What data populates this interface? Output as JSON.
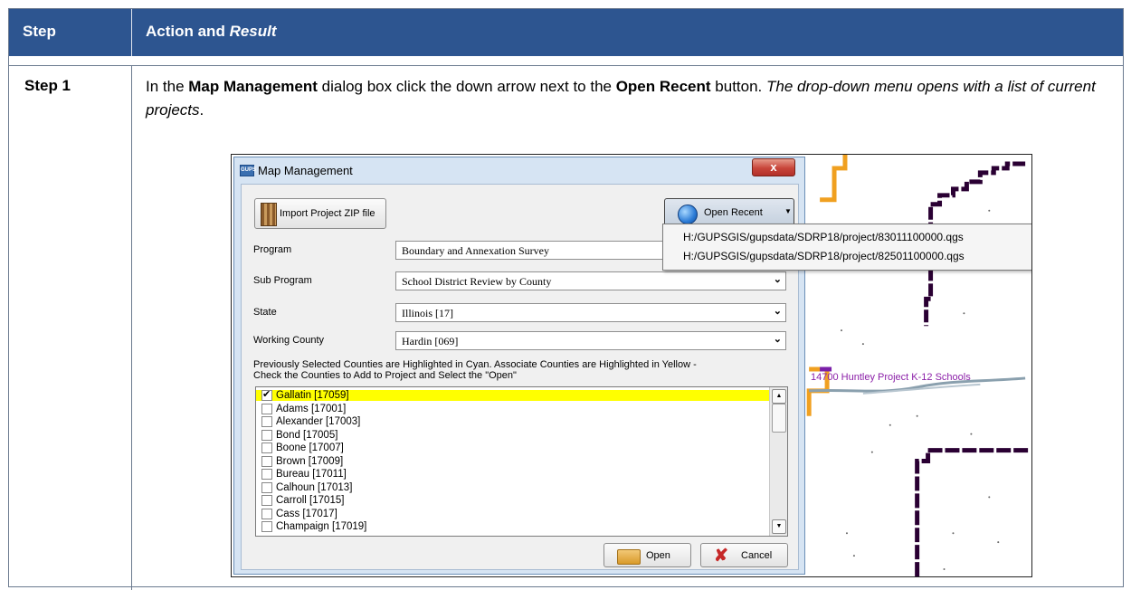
{
  "table": {
    "header_step": "Step",
    "header_action": "Action and",
    "header_result": "Result",
    "step_label": "Step 1",
    "instruction": {
      "p1": "In the ",
      "b1": "Map Management",
      "p2": " dialog box click the down arrow next to the ",
      "b2": "Open Recent",
      "p3": " button. ",
      "i1": "The drop-down menu opens with a list of current projects",
      "p4": "."
    }
  },
  "dialog": {
    "title": "Map Management",
    "app_icon_text": "GUPS",
    "close_label": "x",
    "import_button": "Import Project ZIP file",
    "open_recent_button": "Open Recent",
    "fields": [
      {
        "label": "Program",
        "value": "Boundary and Annexation Survey"
      },
      {
        "label": "Sub Program",
        "value": "School District Review by County"
      },
      {
        "label": "State",
        "value": "Illinois [17]"
      },
      {
        "label": "Working County",
        "value": "Hardin [069]"
      }
    ],
    "hint_line1": "Previously Selected Counties are Highlighted in Cyan. Associate Counties are Highlighted in Yellow -",
    "hint_line2": "Check the Counties to Add to Project and Select the \"Open\"",
    "counties": [
      {
        "name": "Gallatin [17059]",
        "checked": true,
        "highlight": "#ffff00"
      },
      {
        "name": "Adams [17001]",
        "checked": false
      },
      {
        "name": "Alexander [17003]",
        "checked": false
      },
      {
        "name": "Bond [17005]",
        "checked": false
      },
      {
        "name": "Boone [17007]",
        "checked": false
      },
      {
        "name": "Brown [17009]",
        "checked": false
      },
      {
        "name": "Bureau [17011]",
        "checked": false
      },
      {
        "name": "Calhoun [17013]",
        "checked": false
      },
      {
        "name": "Carroll [17015]",
        "checked": false
      },
      {
        "name": "Cass [17017]",
        "checked": false
      },
      {
        "name": "Champaign [17019]",
        "checked": false
      }
    ],
    "open_button": "Open",
    "cancel_button": "Cancel"
  },
  "recent_menu": {
    "items": [
      "H:/GUPSGIS/gupsdata/SDRP18/project/83011100000.qgs",
      "H:/GUPSGIS/gupsdata/SDRP18/project/82501100000.qgs"
    ]
  },
  "map": {
    "label": "14700 Huntley Project K-12 Schools"
  },
  "colors": {
    "header_bg": "#2d5590",
    "highlight": "#ffff00",
    "boundary_orange": "#f0a020",
    "boundary_dark": "#2a0033",
    "river": "#7a8f9c"
  }
}
